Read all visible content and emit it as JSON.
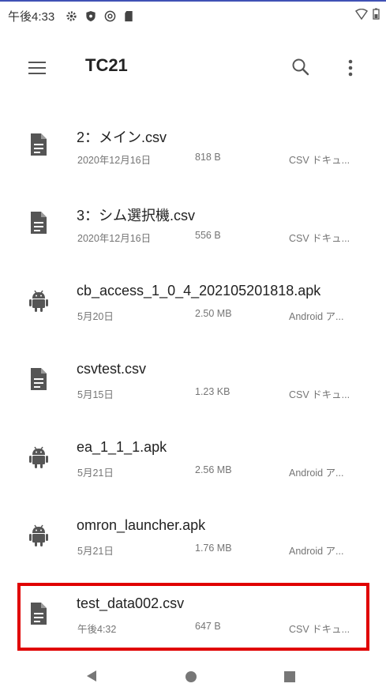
{
  "status_bar": {
    "time": "午後4:33",
    "icons": [
      "gear-icon",
      "shield-icon",
      "at-icon",
      "sd-card-icon"
    ],
    "right_icons": [
      "wifi-icon",
      "battery-icon"
    ]
  },
  "app_bar": {
    "title": "TC21",
    "icons": [
      "menu-icon",
      "search-icon",
      "more-vert-icon"
    ]
  },
  "files": [
    {
      "name": "2：メイン.csv",
      "date": "2020年12月16日",
      "size": "818 B",
      "type": "CSV ドキュ...",
      "icon": "document-icon"
    },
    {
      "name": "3：シム選択機.csv",
      "date": "2020年12月16日",
      "size": "556 B",
      "type": "CSV ドキュ...",
      "icon": "document-icon"
    },
    {
      "name": "cb_access_1_0_4_202105201818.apk",
      "date": "5月20日",
      "size": "2.50 MB",
      "type": "Android ア...",
      "icon": "android-icon"
    },
    {
      "name": "csvtest.csv",
      "date": "5月15日",
      "size": "1.23 KB",
      "type": "CSV ドキュ...",
      "icon": "document-icon"
    },
    {
      "name": "ea_1_1_1.apk",
      "date": "5月21日",
      "size": "2.56 MB",
      "type": "Android ア...",
      "icon": "android-icon"
    },
    {
      "name": "omron_launcher.apk",
      "date": "5月21日",
      "size": "1.76 MB",
      "type": "Android ア...",
      "icon": "android-icon"
    },
    {
      "name": "test_data002.csv",
      "date": "午後4:32",
      "size": "647 B",
      "type": "CSV ドキュ...",
      "icon": "document-icon"
    }
  ],
  "highlight_color": "#e00000",
  "accent_color": "#3f51b5"
}
